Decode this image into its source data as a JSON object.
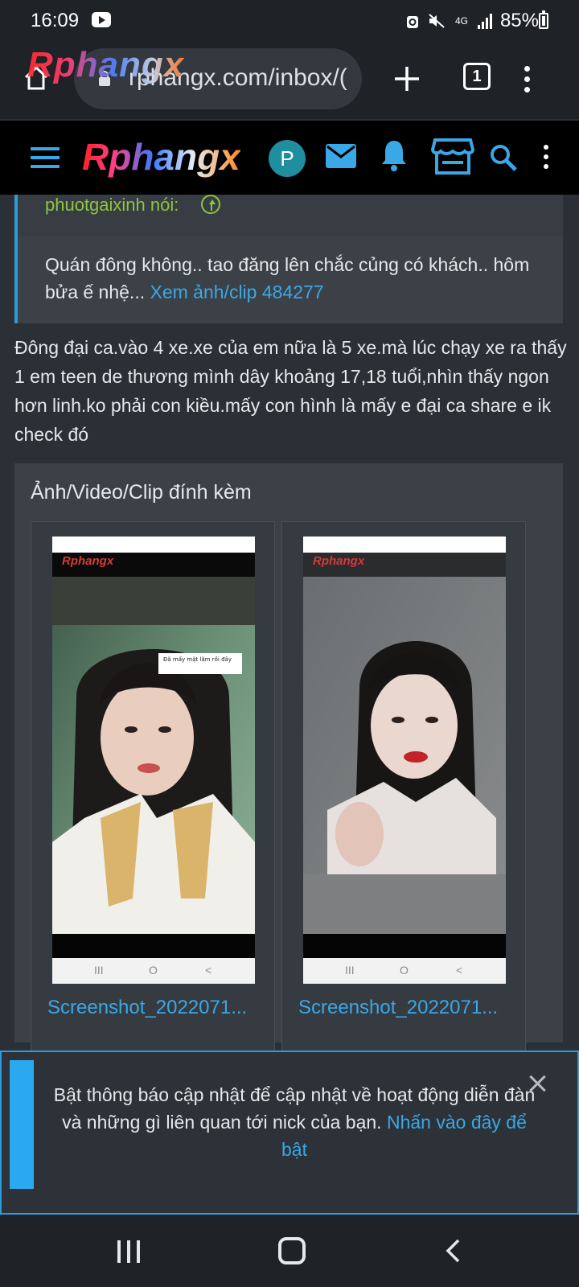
{
  "status_bar": {
    "time": "16:09",
    "network": "4G",
    "battery": "85%",
    "battery_level": 0.85
  },
  "browser": {
    "url": "rphangx.com/inbox/(",
    "logo_text": "Rphangx",
    "tab_count": "1"
  },
  "site_nav": {
    "logo_text": "Rphangx",
    "avatar_initial": "P"
  },
  "quote": {
    "author": "phuotgaixinh nói:",
    "body": "Quán đông không.. tao đăng lên chắc củng có khách.. hôm bửa ế nhệ... ",
    "link": "Xem ảnh/clip 484277"
  },
  "post": {
    "text": "Đông đại ca.vào 4 xe.xe của em nữa là 5 xe.mà lúc chạy xe ra thấy 1 em teen de thương mình dây khoảng 17,18 tuổi,nhìn thấy ngon hơn linh.ko phải con kiều.mấy con hình là mấy e đại ca share e ik check đó"
  },
  "attachments": {
    "title": "Ảnh/Video/Clip đính kèm",
    "items": [
      {
        "name": "Screenshot_2022071...",
        "overlay_logo": "Rphangx",
        "caption": "Đã mấy mặt lắm rồi đấy"
      },
      {
        "name": "Screenshot_2022071...",
        "overlay_logo": "Rphangx"
      }
    ]
  },
  "notice": {
    "text": "Bật thông báo cập nhật để cập nhật về hoạt động diễn đàn và những gì liên quan tới nick của bạn. ",
    "link": "Nhấn vào đây để bật"
  },
  "colors": {
    "accent": "#3aa8e6",
    "quote_author": "#8cc63f",
    "notice_accent": "#2ba9f0",
    "background": "#2b2f36"
  },
  "icons": [
    "home-icon",
    "lock-icon",
    "plus-icon",
    "tabs-icon",
    "more-vert-icon",
    "menu-icon",
    "mail-icon",
    "bell-icon",
    "store-icon",
    "search-icon",
    "arrow-up-circle-icon",
    "close-icon",
    "recents-icon",
    "home-nav-icon",
    "back-icon"
  ]
}
